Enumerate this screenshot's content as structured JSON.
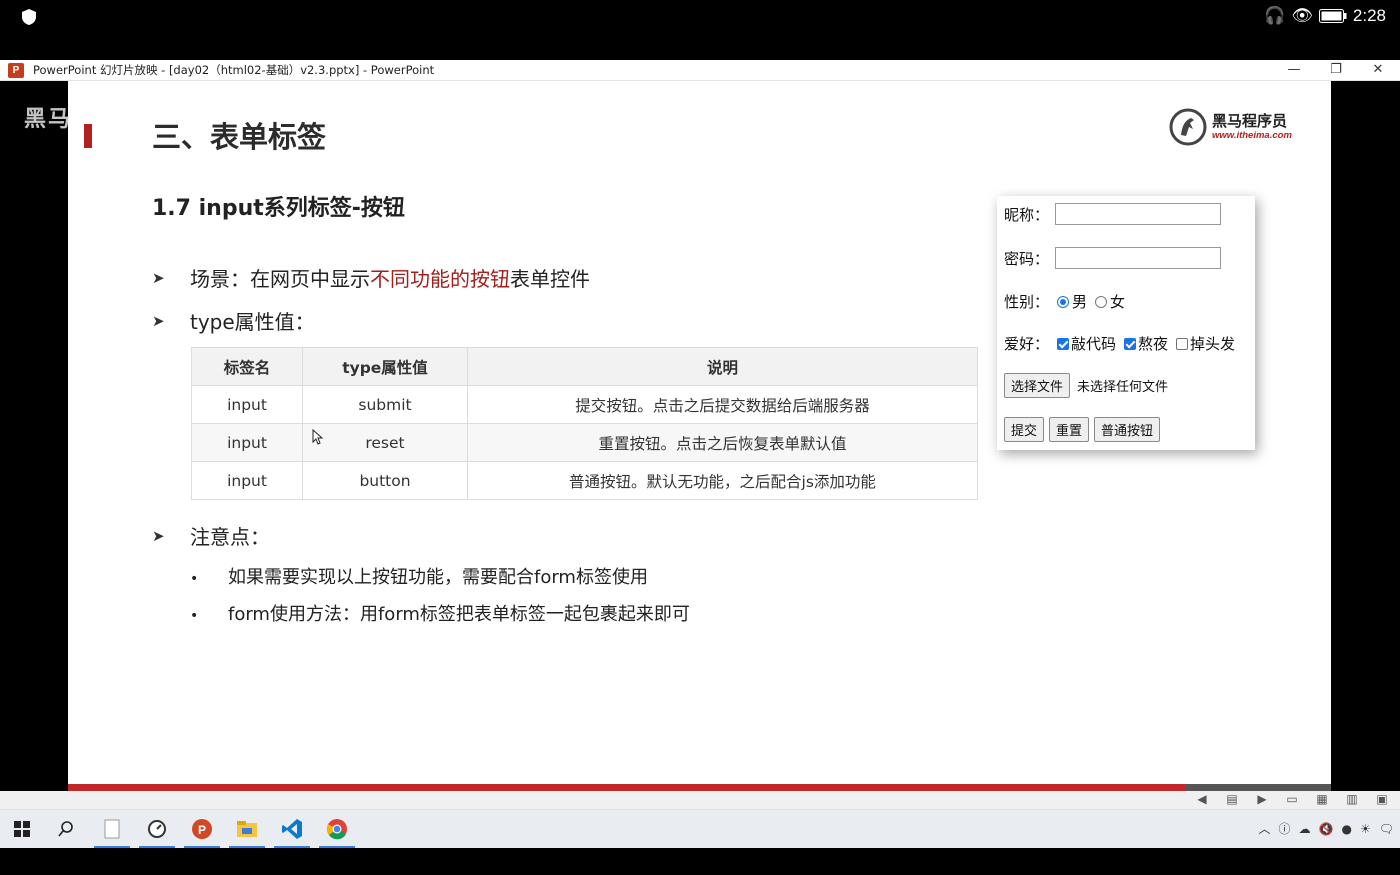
{
  "status_bar": {
    "time": "2:28"
  },
  "window": {
    "title": "PowerPoint 幻灯片放映 - [day02（html02-基础）v2.3.pptx] - PowerPoint",
    "app_badge": "P",
    "minimize": "—",
    "restore": "❐",
    "close": "✕"
  },
  "watermark": "黑马",
  "slide": {
    "title": "三、表单标签",
    "brand_name": "黑马程序员",
    "brand_url": "www.itheima.com",
    "subtitle": "1.7 input系列标签-按钮",
    "scene_prefix": "场景：在网页中显示",
    "scene_highlight": "不同功能的按钮",
    "scene_suffix": "表单控件",
    "type_heading": "type属性值：",
    "table": {
      "headers": [
        "标签名",
        "type属性值",
        "说明"
      ],
      "rows": [
        [
          "input",
          "submit",
          "提交按钮。点击之后提交数据给后端服务器"
        ],
        [
          "input",
          "reset",
          "重置按钮。点击之后恢复表单默认值"
        ],
        [
          "input",
          "button",
          "普通按钮。默认无功能，之后配合js添加功能"
        ]
      ]
    },
    "notes_heading": "注意点：",
    "notes": [
      "如果需要实现以上按钮功能，需要配合form标签使用",
      "form使用方法：用form标签把表单标签一起包裹起来即可"
    ],
    "progress_fraction": 0.885
  },
  "demo_form": {
    "nickname_label": "昵称：",
    "password_label": "密码：",
    "gender_label": "性别：",
    "male": "男",
    "female": "女",
    "hobby_label": "爱好：",
    "hobbies": [
      "敲代码",
      "熬夜",
      "掉头发"
    ],
    "file_button": "选择文件",
    "file_status": "未选择任何文件",
    "submit": "提交",
    "reset": "重置",
    "button": "普通按钮"
  },
  "colors": {
    "accent": "#b1211f",
    "radio_check": "#1a73e8"
  }
}
